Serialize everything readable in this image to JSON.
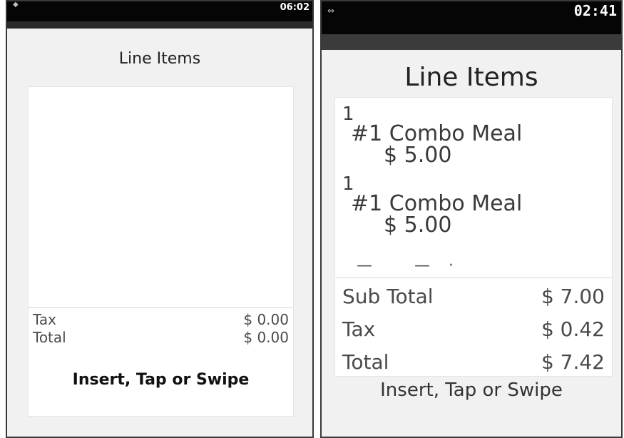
{
  "left_screen": {
    "status_time": "06:02",
    "status_icon": "wifi-icon",
    "title": "Line Items",
    "totals": [
      {
        "label": "Tax",
        "value": "$ 0.00"
      },
      {
        "label": "Total",
        "value": "$ 0.00"
      }
    ],
    "prompt": "Insert, Tap or Swipe"
  },
  "right_screen": {
    "status_time": "02:41",
    "status_icon": "connection-arrows-icon",
    "title": "Line Items",
    "line_items": [
      {
        "qty": "1",
        "name": "#1 Combo Meal",
        "price": "$ 5.00"
      },
      {
        "qty": "1",
        "name": "#1 Combo Meal",
        "price": "$ 5.00"
      }
    ],
    "totals": [
      {
        "label": "Sub Total",
        "value": "$ 7.00"
      },
      {
        "label": "Tax",
        "value": "$ 0.42"
      },
      {
        "label": "Total",
        "value": "$ 7.42"
      }
    ],
    "prompt": "Insert, Tap or Swipe"
  }
}
